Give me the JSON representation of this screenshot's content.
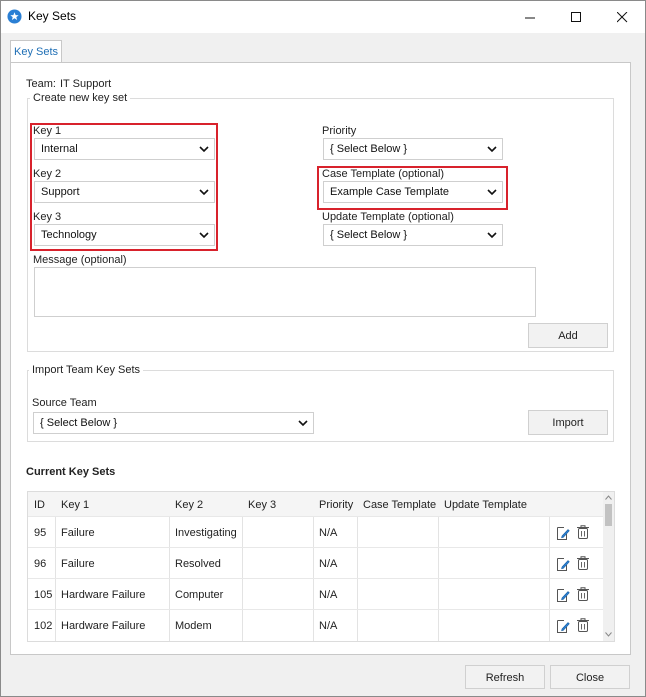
{
  "window": {
    "title": "Key Sets"
  },
  "tab": {
    "label": "Key Sets"
  },
  "team": {
    "label": "Team:",
    "value": "IT Support"
  },
  "create": {
    "group_title": "Create new key set",
    "key1": {
      "label": "Key 1",
      "value": "Internal"
    },
    "key2": {
      "label": "Key 2",
      "value": "Support"
    },
    "key3": {
      "label": "Key 3",
      "value": "Technology"
    },
    "priority": {
      "label": "Priority",
      "value": "{ Select Below }"
    },
    "case_template": {
      "label": "Case Template (optional)",
      "value": "Example Case Template"
    },
    "update_template": {
      "label": "Update Template (optional)",
      "value": "{ Select Below }"
    },
    "message": {
      "label": "Message (optional)",
      "value": ""
    },
    "add_label": "Add"
  },
  "import": {
    "group_title": "Import Team Key Sets",
    "source_label": "Source Team",
    "source_value": "{ Select Below }",
    "import_label": "Import"
  },
  "current": {
    "title": "Current Key Sets",
    "columns": [
      "ID",
      "Key 1",
      "Key 2",
      "Key 3",
      "Priority",
      "Case Template",
      "Update Template"
    ],
    "rows": [
      {
        "id": "95",
        "key1": "Failure",
        "key2": "Investigating",
        "key3": "",
        "priority": "N/A",
        "case": "",
        "update": ""
      },
      {
        "id": "96",
        "key1": "Failure",
        "key2": "Resolved",
        "key3": "",
        "priority": "N/A",
        "case": "",
        "update": ""
      },
      {
        "id": "105",
        "key1": "Hardware Failure",
        "key2": "Computer",
        "key3": "",
        "priority": "N/A",
        "case": "",
        "update": ""
      },
      {
        "id": "102",
        "key1": "Hardware Failure",
        "key2": "Modem",
        "key3": "",
        "priority": "N/A",
        "case": "",
        "update": ""
      }
    ]
  },
  "footer": {
    "refresh_label": "Refresh",
    "close_label": "Close"
  },
  "colors": {
    "highlight": "#d8222c",
    "tab_text": "#1f6fb5",
    "app_icon": "#2a7fd4"
  }
}
